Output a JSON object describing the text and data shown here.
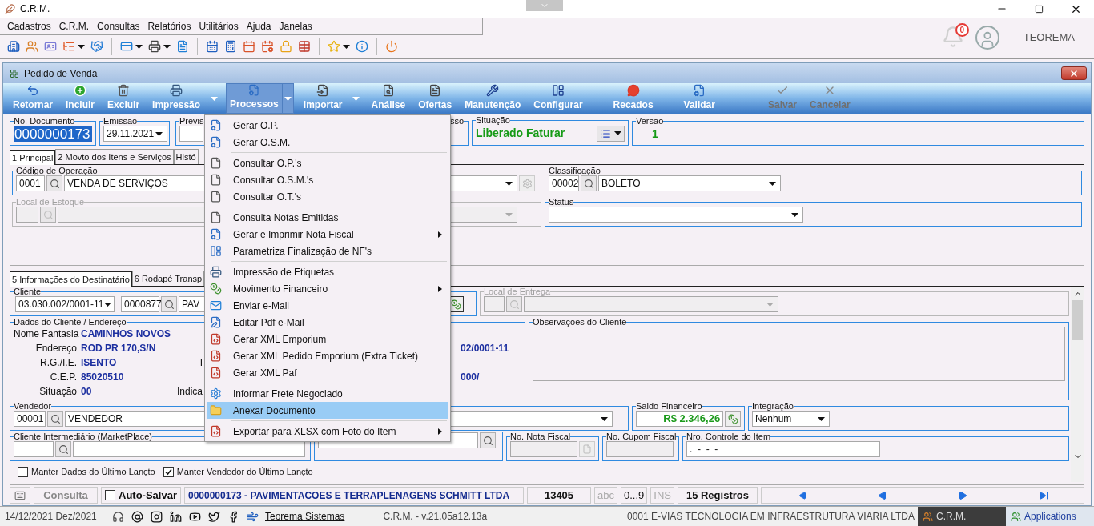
{
  "app": {
    "title": "C.R.M."
  },
  "menu_bar": [
    "Cadastros",
    "C.R.M.",
    "Consultas",
    "Relatórios",
    "Utilitários",
    "Ajuda",
    "Janelas"
  ],
  "notifications": {
    "count": "0"
  },
  "user": {
    "name": "TEOREMA"
  },
  "window": {
    "title": "Pedido de Venda"
  },
  "ribbon": [
    {
      "label": "Retornar",
      "dropdown": false,
      "selected": false,
      "disabled": false
    },
    {
      "label": "Incluir",
      "dropdown": false,
      "selected": false,
      "disabled": false
    },
    {
      "label": "Excluir",
      "dropdown": false,
      "selected": false,
      "disabled": false
    },
    {
      "label": "Impressão",
      "dropdown": true,
      "selected": false,
      "disabled": false
    },
    {
      "label": "Processos",
      "dropdown": true,
      "selected": true,
      "disabled": false
    },
    {
      "label": "Importar",
      "dropdown": true,
      "selected": false,
      "disabled": false
    },
    {
      "label": "Análise",
      "dropdown": false,
      "selected": false,
      "disabled": false
    },
    {
      "label": "Ofertas",
      "dropdown": false,
      "selected": false,
      "disabled": false
    },
    {
      "label": "Manutenção",
      "dropdown": false,
      "selected": false,
      "disabled": false
    },
    {
      "label": "Configurar",
      "dropdown": false,
      "selected": false,
      "disabled": false
    },
    {
      "label": "Recados",
      "dropdown": false,
      "selected": false,
      "disabled": false
    },
    {
      "label": "Validar",
      "dropdown": false,
      "selected": false,
      "disabled": false
    },
    {
      "label": "Salvar",
      "dropdown": false,
      "selected": false,
      "disabled": true
    },
    {
      "label": "Cancelar",
      "dropdown": false,
      "selected": false,
      "disabled": true
    }
  ],
  "header": {
    "document": {
      "label": "No. Documento",
      "value": "0000000173"
    },
    "emissao": {
      "label": "Emissão",
      "value": "29.11.2021"
    },
    "previsao": {
      "label": "Previs"
    },
    "processo": {
      "label": "sso"
    },
    "situacao": {
      "label": "Situação",
      "value": "Liberado Faturar"
    },
    "versao": {
      "label": "Versão",
      "value": "1"
    }
  },
  "tabs_top": [
    {
      "label": "1 Principal",
      "selected": true
    },
    {
      "label": "2 Movto dos Itens e Serviços",
      "selected": false
    },
    {
      "label": "Histó",
      "selected": false
    }
  ],
  "operacao": {
    "label": "Código de Operação",
    "code": "0001",
    "value": "VENDA DE SERVIÇOS"
  },
  "classificacao": {
    "label": "Classificação",
    "code": "00002",
    "value": "BOLETO"
  },
  "local_estoque": {
    "label": "Local de Estoque",
    "disabled": true
  },
  "status": {
    "label": "Status"
  },
  "tabs_bottom": [
    {
      "label": "5 Informações do Destinatário",
      "selected": true
    },
    {
      "label": "6 Rodapé Transp",
      "selected": false
    }
  ],
  "cliente": {
    "label": "Cliente",
    "document": "03.030.002/0001-11",
    "code": "0000877",
    "name": "PAV"
  },
  "local_entrega": {
    "label": "Local de Entrega",
    "disabled": true
  },
  "dados_cliente": {
    "label": "Dados do Cliente / Endereço",
    "rows": [
      {
        "label": "Nome Fantasia",
        "value": "CAMINHOS NOVOS"
      },
      {
        "label": "Endereço",
        "value": "ROD PR 170,S/N",
        "column_3": "02/0001-11"
      },
      {
        "label": "R.G./I.E.",
        "value": "ISENTO",
        "column_2": "I"
      },
      {
        "label": "C.E.P.",
        "value": "85020510",
        "column_3": "000/"
      },
      {
        "label": "Situação",
        "value": "00",
        "column_2": "Indica"
      }
    ]
  },
  "observacoes": {
    "label": "Observações do Cliente"
  },
  "vendedor": {
    "label": "Vendedor",
    "code": "00001",
    "value": "VENDEDOR"
  },
  "saldo": {
    "label": "Saldo Financeiro",
    "value": "R$ 2.346,26"
  },
  "integracao": {
    "label": "Integração",
    "value": "Nenhum"
  },
  "intermediario": {
    "label": "Cliente Intermediário (MarketPlace)"
  },
  "nota_fiscal": {
    "label": "No. Nota Fiscal"
  },
  "cupom_fiscal": {
    "label": "No. Cupom Fiscal"
  },
  "controle_item": {
    "label": "Nro. Controle do Item",
    "value": ".  -  -  -"
  },
  "options": [
    {
      "label": "Manter Dados do Último Lançto",
      "checked": false
    },
    {
      "label": "Manter Vendedor do Último Lançto",
      "checked": true
    }
  ],
  "status_bar": {
    "mode": "Consulta",
    "auto_save": {
      "label": "Auto-Salvar",
      "checked": false
    },
    "record": "0000000173 - PAVIMENTACOES E TERRAPLENAGENS SCHMITT LTDA",
    "number": "13405",
    "indicators": [
      {
        "label": "abc",
        "on": false
      },
      {
        "label": "0...9",
        "on": true
      },
      {
        "label": "INS",
        "on": false
      }
    ],
    "count": "15 Registros"
  },
  "footer": {
    "date": "14/12/2021 Dez/2021",
    "link": "Teorema Sistemas",
    "version": "C.R.M. - v.21.05a12.13a",
    "company": "0001 E-VIAS TECNOLOGIA EM INFRAESTRUTURA VIARIA LTDA"
  },
  "taskbar": [
    {
      "label": "C.R.M.",
      "selected": true
    },
    {
      "label": "Applications",
      "selected": false
    }
  ],
  "process_menu": [
    [
      {
        "label": "Gerar O.P.",
        "submenu": false,
        "selected": false
      },
      {
        "label": "Gerar O.S.M.",
        "submenu": false,
        "selected": false
      }
    ],
    [
      {
        "label": "Consultar O.P.'s",
        "submenu": false,
        "selected": false
      },
      {
        "label": "Consultar O.S.M.'s",
        "submenu": false,
        "selected": false
      },
      {
        "label": "Consultar O.T.'s",
        "submenu": false,
        "selected": false
      }
    ],
    [
      {
        "label": "Consulta Notas Emitidas",
        "submenu": false,
        "selected": false
      },
      {
        "label": "Gerar e Imprimir Nota Fiscal",
        "submenu": true,
        "selected": false
      },
      {
        "label": "Parametriza Finalização de NF's",
        "submenu": false,
        "selected": false
      }
    ],
    [
      {
        "label": "Impressão de Etiquetas",
        "submenu": false,
        "selected": false
      },
      {
        "label": "Movimento Financeiro",
        "submenu": true,
        "selected": false
      },
      {
        "label": "Enviar e-Mail",
        "submenu": false,
        "selected": false
      },
      {
        "label": "Editar Pdf e-Mail",
        "submenu": false,
        "selected": false
      },
      {
        "label": "Gerar XML Emporium",
        "submenu": false,
        "selected": false
      },
      {
        "label": "Gerar XML Pedido Emporium (Extra Ticket)",
        "submenu": false,
        "selected": false
      },
      {
        "label": "Gerar XML Paf",
        "submenu": false,
        "selected": false
      }
    ],
    [
      {
        "label": "Informar Frete Negociado",
        "submenu": false,
        "selected": false
      },
      {
        "label": "Anexar Documento",
        "submenu": false,
        "selected": true
      }
    ],
    [
      {
        "label": "Exportar para XLSX com Foto do Item",
        "submenu": true,
        "selected": false
      }
    ]
  ]
}
